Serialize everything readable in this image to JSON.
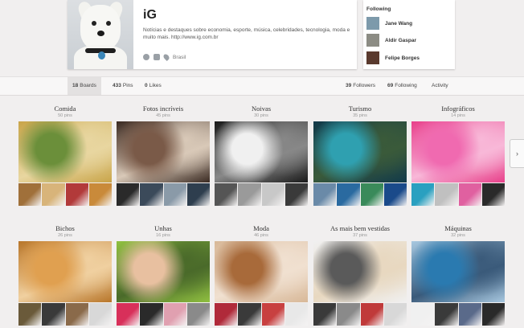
{
  "profile": {
    "name": "iG",
    "bio": "Notícias e destaques sobre economia, esporte, música, celebridades, tecnologia, moda e muito mais. http://www.ig.com.br",
    "location": "Brasil"
  },
  "following": {
    "title": "Following",
    "people": [
      {
        "name": "Jane Wang",
        "avatar_color": "#7d9aab"
      },
      {
        "name": "Aldir Gaspar",
        "avatar_color": "#8c8c84"
      },
      {
        "name": "Felipe Borges",
        "avatar_color": "#5a3a2e"
      }
    ]
  },
  "nav": {
    "boards": {
      "count": "18",
      "label": "Boards"
    },
    "pins": {
      "count": "433",
      "label": "Pins"
    },
    "likes": {
      "count": "0",
      "label": "Likes"
    },
    "followers": {
      "count": "39",
      "label": "Followers"
    },
    "following": {
      "count": "69",
      "label": "Following"
    },
    "activity": {
      "label": "Activity"
    }
  },
  "next_arrow": "›",
  "boards": [
    {
      "title": "Comida",
      "count": "50 pins",
      "cover": [
        "#c9a54a",
        "#6b8f3a",
        "#e8d6a0"
      ],
      "thumbs": [
        "#a0703a",
        "#d8b47a",
        "#b23a3a",
        "#c98a3a"
      ]
    },
    {
      "title": "Fotos incríveis",
      "count": "45 pins",
      "cover": [
        "#3a2a22",
        "#7a5a48",
        "#d9c9b8"
      ],
      "thumbs": [
        "#2a2a2a",
        "#3b4a5a",
        "#8a9aa8",
        "#2e3e4e"
      ]
    },
    {
      "title": "Noivas",
      "count": "30 pins",
      "cover": [
        "#1a1a1a",
        "#f0f0f0",
        "#888888"
      ],
      "thumbs": [
        "#555555",
        "#9a9a9a",
        "#c8c8c8",
        "#3a3a3a"
      ]
    },
    {
      "title": "Turismo",
      "count": "35 pins",
      "cover": [
        "#123a4a",
        "#2fa0b0",
        "#3a5a3a"
      ],
      "thumbs": [
        "#6a8aa8",
        "#2a6aa0",
        "#3a8a5a",
        "#1a4a8a"
      ]
    },
    {
      "title": "Infográficos",
      "count": "14 pins",
      "cover": [
        "#e8408a",
        "#f06ab0",
        "#f8b8d8"
      ],
      "thumbs": [
        "#2aa0c0",
        "#c0c0c0",
        "#e060a0",
        "#2a2a2a"
      ]
    },
    {
      "title": "Bichos",
      "count": "26 pins",
      "cover": [
        "#b8762a",
        "#e0a050",
        "#f0d0a0"
      ],
      "thumbs": [
        "#6a5a3a",
        "#3a3a3a",
        "#8a6a4a",
        "#d8d8d8"
      ]
    },
    {
      "title": "Unhas",
      "count": "16 pins",
      "cover": [
        "#90c040",
        "#e8c0a0",
        "#4a6a2a"
      ],
      "thumbs": [
        "#d8305a",
        "#2a2a2a",
        "#e0a0b0",
        "#8a8a8a"
      ]
    },
    {
      "title": "Moda",
      "count": "46 pins",
      "cover": [
        "#d8b898",
        "#a86a3a",
        "#f0e0d0"
      ],
      "thumbs": [
        "#b02a3a",
        "#3a3a3a",
        "#c84040",
        "#e8e8e8"
      ]
    },
    {
      "title": "As mais bem vestidas",
      "count": "37 pins",
      "cover": [
        "#f0f0f0",
        "#5a5a5a",
        "#e8d8c0"
      ],
      "thumbs": [
        "#3a3a3a",
        "#8a8a8a",
        "#c03a3a",
        "#d8d8d8"
      ]
    },
    {
      "title": "Máquinas",
      "count": "32 pins",
      "cover": [
        "#a8c8e0",
        "#2a7ab0",
        "#3a5a7a"
      ],
      "thumbs": [
        "#f0f0f0",
        "#3a3a3a",
        "#5a6a8a",
        "#2a2a2a"
      ]
    }
  ]
}
